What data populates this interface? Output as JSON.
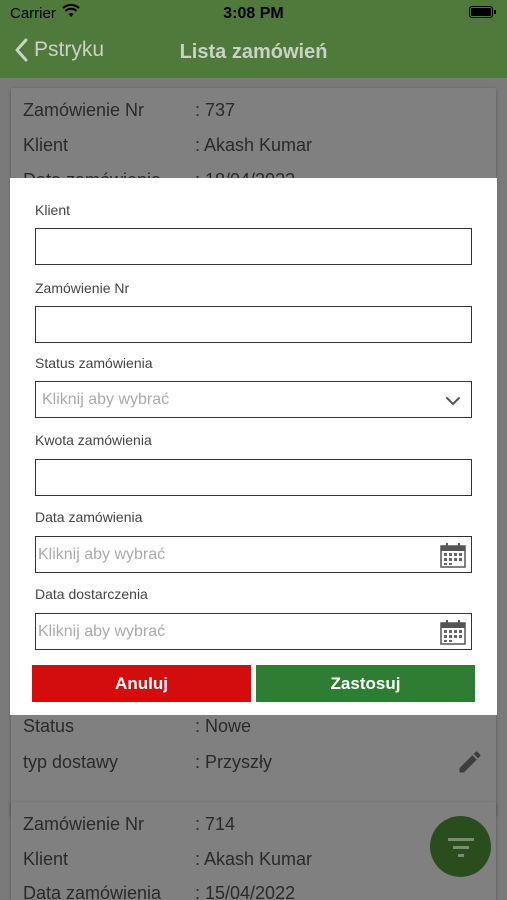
{
  "status_bar": {
    "carrier": "Carrier",
    "time": "3:08 PM"
  },
  "nav": {
    "back_label": "Pstryku",
    "title": "Lista zamówień"
  },
  "orders": [
    {
      "fields": [
        {
          "label": "Zamówienie Nr",
          "value": ": 737"
        },
        {
          "label": "Klient",
          "value": ": Akash Kumar"
        },
        {
          "label": "Data zamówienia",
          "value": ": 18/04/2022"
        }
      ],
      "tail": [
        {
          "label": "Status",
          "value": ": Nowe"
        },
        {
          "label": "typ dostawy",
          "value": ": Przyszły"
        }
      ]
    },
    {
      "fields": [
        {
          "label": "Zamówienie Nr",
          "value": ": 714"
        },
        {
          "label": "Klient",
          "value": ": Akash Kumar"
        },
        {
          "label": "Data zamówienia",
          "value": ": 15/04/2022"
        }
      ]
    }
  ],
  "filter": {
    "client_label": "Klient",
    "client_value": "",
    "order_no_label": "Zamówienie Nr",
    "order_no_value": "",
    "status_label": "Status zamówienia",
    "status_placeholder": "Kliknij aby wybrać",
    "amount_label": "Kwota zamówienia",
    "amount_value": "",
    "order_date_label": "Data zamówienia",
    "order_date_placeholder": "Kliknij aby wybrać",
    "delivery_date_label": "Data dostarczenia",
    "delivery_date_placeholder": "Kliknij aby wybrać",
    "cancel_label": "Anuluj",
    "apply_label": "Zastosuj"
  },
  "colors": {
    "nav": "#5e9a45",
    "cancel": "#d30d0d",
    "apply": "#2e7d32",
    "fab": "#2a4d1e"
  },
  "icons": [
    "wifi-icon",
    "battery-icon",
    "back-chevron-icon",
    "edit-pencil-icon",
    "filter-icon",
    "chevron-down-icon",
    "calendar-icon"
  ]
}
